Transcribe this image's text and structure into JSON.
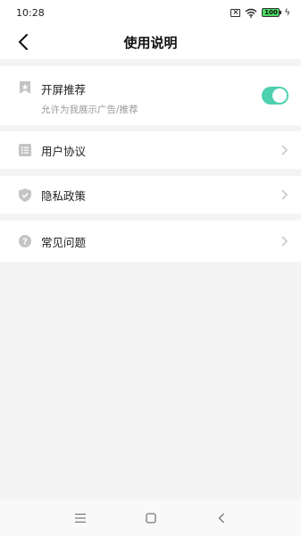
{
  "status_bar": {
    "time": "10:28",
    "battery": "100",
    "icons": [
      "sim-off-icon",
      "wifi-icon",
      "battery-icon",
      "charging-icon"
    ]
  },
  "header": {
    "title": "使用说明",
    "back_icon": "back-arrow-icon"
  },
  "settings": [
    {
      "label": "开屏推荐",
      "subtitle": "允许为我展示广告/推荐",
      "icon": "bookmark-star-icon",
      "control": "toggle",
      "enabled": true
    },
    {
      "label": "用户协议",
      "icon": "document-list-icon",
      "control": "chevron"
    },
    {
      "label": "隐私政策",
      "icon": "shield-check-icon",
      "control": "chevron"
    },
    {
      "label": "常见问题",
      "icon": "help-circle-icon",
      "control": "chevron"
    }
  ],
  "colors": {
    "accent": "#4fd0b0",
    "background": "#f4f4f4",
    "icon_gray": "#c4c4c4",
    "subtitle": "#9a9a9a"
  },
  "system_nav": [
    "menu-icon",
    "home-icon",
    "back-icon"
  ]
}
